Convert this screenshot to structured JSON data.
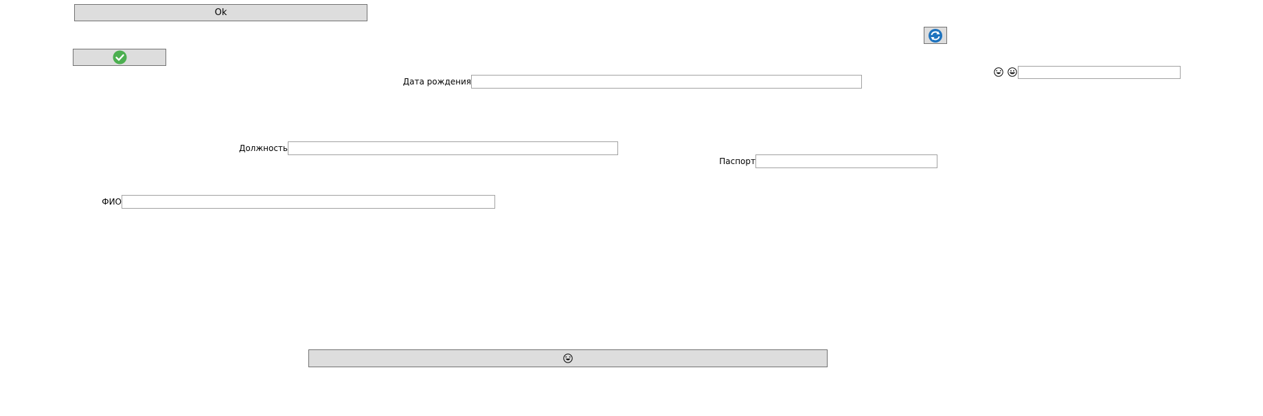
{
  "buttons": {
    "ok_label": "Ok",
    "check_icon": "check-circle-icon",
    "refresh_icon": "refresh-icon",
    "bottom_icon": "smiley-icon"
  },
  "fields": {
    "birth_date": {
      "label": "Дата рождения",
      "value": ""
    },
    "position": {
      "label": "Должность",
      "value": ""
    },
    "passport": {
      "label": "Паспорт",
      "value": ""
    },
    "full_name": {
      "label": "ФИО",
      "value": ""
    },
    "top_right": {
      "value": ""
    }
  },
  "icons": {
    "emoji_1": "laughing-face-icon",
    "emoji_2": "grinning-face-icon"
  },
  "colors": {
    "button_bg": "#dddddd",
    "check_green": "#4caf50",
    "refresh_blue": "#1e73be"
  }
}
